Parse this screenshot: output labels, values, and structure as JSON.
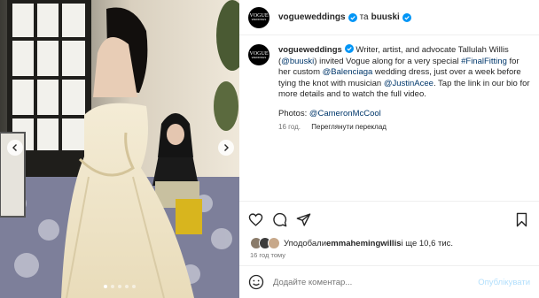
{
  "header": {
    "username": "vogueweddings",
    "separator": "та",
    "collaborator": "buuski"
  },
  "avatar": {
    "line1": "VOGUE",
    "line2": "WEDDINGS"
  },
  "caption": {
    "username": "vogueweddings",
    "part1": " Writer, artist, and advocate Tallulah Willis (",
    "mention1": "@buuski",
    "part2": ") invited Vogue along for a very special ",
    "hashtag": "#FinalFitting",
    "part3": " for her custom ",
    "mention2": "@Balenciaga",
    "part4": " wedding dress, just over a week before tying the knot with musician ",
    "mention3": "@JustinAcee",
    "part5": ". Tap the link in our bio for more details and to watch the full video.",
    "photos_label": "Photos: ",
    "photos_credit": "@CameronMcCool"
  },
  "meta": {
    "age": "16 год.",
    "translate": "Переглянути переклад"
  },
  "likes": {
    "prefix": "Уподобали ",
    "liker": "emmahemingwillis",
    "suffix": " і ще 10,6 тис."
  },
  "post_time": "16 год тому",
  "comment": {
    "placeholder": "Додайте коментар...",
    "post_label": "Опублікувати"
  },
  "carousel": {
    "count": 5,
    "active": 0
  },
  "colors": {
    "verified": "#0095f6",
    "link": "#00376b",
    "post_disabled": "#b2dffc",
    "meta": "#737373"
  },
  "icons": [
    "chevron-left-icon",
    "chevron-right-icon",
    "heart-icon",
    "comment-icon",
    "share-icon",
    "bookmark-icon",
    "emoji-icon",
    "verified-icon"
  ]
}
